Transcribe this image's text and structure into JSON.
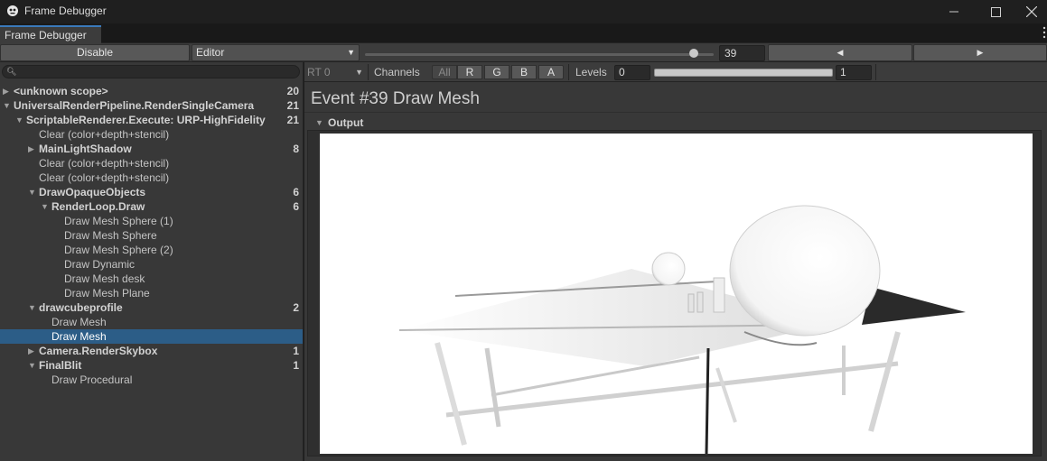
{
  "window": {
    "title": "Frame Debugger",
    "tab_label": "Frame Debugger"
  },
  "toolbar": {
    "disable_label": "Disable",
    "target_label": "Editor",
    "event_index": "39",
    "event_total": 39
  },
  "tree": {
    "search_placeholder": "",
    "rows": [
      {
        "label": "<unknown scope>",
        "count": "20",
        "bold": true,
        "arrow": "right",
        "depth": 0
      },
      {
        "label": "UniversalRenderPipeline.RenderSingleCamera",
        "count": "21",
        "bold": true,
        "arrow": "down",
        "depth": 0
      },
      {
        "label": "ScriptableRenderer.Execute: URP-HighFidelity",
        "count": "21",
        "bold": true,
        "arrow": "down",
        "depth": 1
      },
      {
        "label": "Clear (color+depth+stencil)",
        "count": "",
        "bold": false,
        "arrow": "",
        "depth": 2
      },
      {
        "label": "MainLightShadow",
        "count": "8",
        "bold": true,
        "arrow": "right",
        "depth": 2
      },
      {
        "label": "Clear (color+depth+stencil)",
        "count": "",
        "bold": false,
        "arrow": "",
        "depth": 2
      },
      {
        "label": "Clear (color+depth+stencil)",
        "count": "",
        "bold": false,
        "arrow": "",
        "depth": 2
      },
      {
        "label": "DrawOpaqueObjects",
        "count": "6",
        "bold": true,
        "arrow": "down",
        "depth": 2
      },
      {
        "label": "RenderLoop.Draw",
        "count": "6",
        "bold": true,
        "arrow": "down",
        "depth": 3
      },
      {
        "label": "Draw Mesh Sphere (1)",
        "count": "",
        "bold": false,
        "arrow": "",
        "depth": 4
      },
      {
        "label": "Draw Mesh Sphere",
        "count": "",
        "bold": false,
        "arrow": "",
        "depth": 4
      },
      {
        "label": "Draw Mesh Sphere (2)",
        "count": "",
        "bold": false,
        "arrow": "",
        "depth": 4
      },
      {
        "label": "Draw Dynamic",
        "count": "",
        "bold": false,
        "arrow": "",
        "depth": 4
      },
      {
        "label": "Draw Mesh desk",
        "count": "",
        "bold": false,
        "arrow": "",
        "depth": 4
      },
      {
        "label": "Draw Mesh Plane",
        "count": "",
        "bold": false,
        "arrow": "",
        "depth": 4
      },
      {
        "label": "drawcubeprofile",
        "count": "2",
        "bold": true,
        "arrow": "down",
        "depth": 2
      },
      {
        "label": "Draw Mesh",
        "count": "",
        "bold": false,
        "arrow": "",
        "depth": 3
      },
      {
        "label": "Draw Mesh",
        "count": "",
        "bold": false,
        "arrow": "",
        "depth": 3,
        "selected": true
      },
      {
        "label": "Camera.RenderSkybox",
        "count": "1",
        "bold": true,
        "arrow": "right",
        "depth": 2
      },
      {
        "label": "FinalBlit",
        "count": "1",
        "bold": true,
        "arrow": "down",
        "depth": 2
      },
      {
        "label": "Draw Procedural",
        "count": "",
        "bold": false,
        "arrow": "",
        "depth": 3
      }
    ]
  },
  "details": {
    "rt_label": "RT 0",
    "channels_label": "Channels",
    "channels": [
      "All",
      "R",
      "G",
      "B",
      "A"
    ],
    "levels_label": "Levels",
    "level_min": "0",
    "level_max": "1",
    "event_title": "Event #39 Draw Mesh",
    "output_label": "Output"
  },
  "colors": {
    "accent": "#3a79bb",
    "selection": "#2c5d87",
    "panel": "#383838"
  }
}
